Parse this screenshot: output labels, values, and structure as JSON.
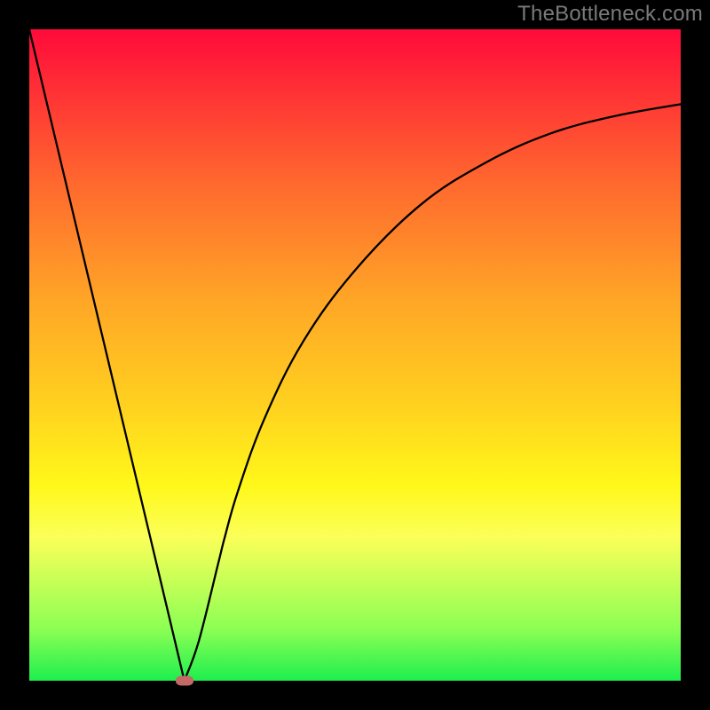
{
  "watermark": "TheBottleneck.com",
  "chart_data": {
    "type": "line",
    "title": "",
    "xlabel": "",
    "ylabel": "",
    "xlim": [
      0,
      1
    ],
    "ylim": [
      0,
      1
    ],
    "series": [
      {
        "name": "curve",
        "x": [
          0.0,
          0.05,
          0.1,
          0.15,
          0.2,
          0.238,
          0.26,
          0.29,
          0.3,
          0.32,
          0.36,
          0.42,
          0.5,
          0.6,
          0.7,
          0.8,
          0.9,
          1.0
        ],
        "y": [
          1.0,
          0.79,
          0.58,
          0.37,
          0.16,
          0.0,
          0.06,
          0.18,
          0.22,
          0.29,
          0.4,
          0.52,
          0.63,
          0.73,
          0.795,
          0.84,
          0.867,
          0.885
        ]
      }
    ],
    "marker": {
      "x": 0.238,
      "y": 0.0
    },
    "background_gradient": {
      "top": "#ff0a3a",
      "mid": "#ffd21f",
      "bottom": "#1eef4e"
    },
    "border_color": "#000000"
  }
}
